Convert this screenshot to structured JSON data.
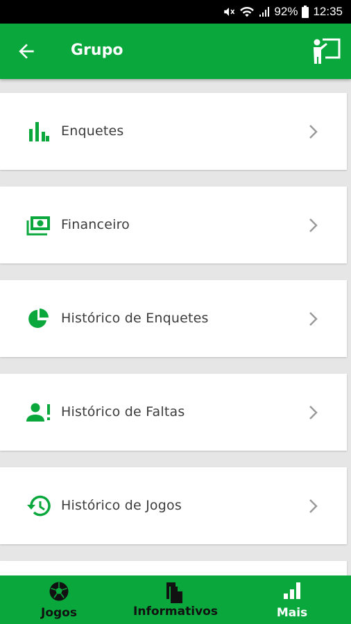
{
  "status_bar": {
    "battery": "92%",
    "time": "12:35"
  },
  "app_bar": {
    "title": "Grupo"
  },
  "menu": [
    {
      "label": "Enquetes",
      "icon": "bar-chart-icon"
    },
    {
      "label": "Financeiro",
      "icon": "money-icon"
    },
    {
      "label": "Histórico de Enquetes",
      "icon": "pie-chart-icon"
    },
    {
      "label": "Histórico de Faltas",
      "icon": "person-alert-icon"
    },
    {
      "label": "Histórico de Jogos",
      "icon": "history-icon"
    }
  ],
  "bottom_nav": [
    {
      "label": "Jogos",
      "icon": "soccer-ball-icon",
      "active": false
    },
    {
      "label": "Informativos",
      "icon": "documents-icon",
      "active": false
    },
    {
      "label": "Mais",
      "icon": "signal-bars-icon",
      "active": true
    }
  ],
  "colors": {
    "primary": "#0aa83c",
    "background": "#e6e6e6",
    "text": "#3b3b3b",
    "chevron": "#9a9a9a"
  }
}
